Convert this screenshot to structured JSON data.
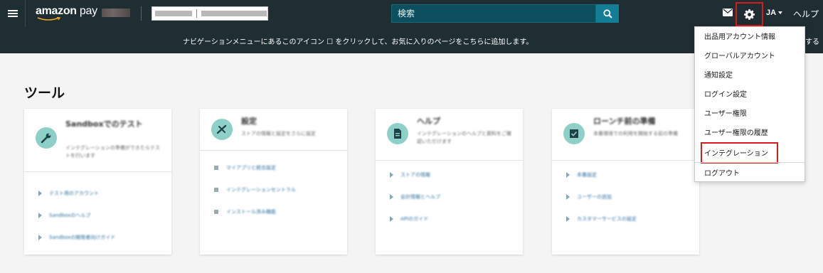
{
  "topbar": {
    "logo_amazon": "amazon",
    "logo_pay": " pay",
    "search_placeholder": "検索",
    "lang_label": "JA",
    "help_label": "ヘルプ",
    "icons": {
      "menu": "hamburger-menu-icon",
      "search": "search-icon",
      "mail": "mail-icon",
      "settings": "gear-icon",
      "lang_caret": "chevron-down-icon"
    }
  },
  "notice": {
    "text": "ナビゲーションメニューにあるこのアイコン ☐ をクリックして、お気に入りのページをこちらに追加します。",
    "suffix": "する"
  },
  "page": {
    "title": "ツール"
  },
  "cards": [
    {
      "title": "Sandboxでのテスト",
      "description": "インテグレーションの準備ができたらテストを行います",
      "icon": "wrench-icon",
      "bullet": "triangle",
      "links": [
        "テスト用のアカウント",
        "Sandboxのヘルプ",
        "Sandboxの開発者向けガイド"
      ]
    },
    {
      "title": "設定",
      "description": "ストアの情報と設定をさらに設定",
      "icon": "tools-icon",
      "bullet": "square",
      "links": [
        "マイアプリと統合設定",
        "インテグレーションセントラル",
        "インストール済み機能"
      ]
    },
    {
      "title": "ヘルプ",
      "description": "インテグレーションのヘルプと資料をご確認いただけます",
      "icon": "document-icon",
      "bullet": "triangle",
      "links": [
        "ストアの情報",
        "会計情報とヘルプ",
        "APIのガイド"
      ]
    },
    {
      "title": "ローンチ前の準備",
      "description": "本番環境での利用を開始する前の準備",
      "icon": "checklist-icon",
      "bullet": "triangle",
      "links": [
        "本番設定",
        "ユーザーの追加",
        "カスタマーサービスの設定"
      ]
    }
  ],
  "settings_menu": {
    "items": [
      "出品用アカウント情報",
      "グローバルアカウント",
      "通知設定",
      "ログイン設定",
      "ユーザー権限",
      "ユーザー権限の履歴",
      "インテグレーション",
      "ログアウト"
    ],
    "highlighted_item": "インテグレーション",
    "highlight_color": "#d81b1b"
  },
  "colors": {
    "topbar_bg": "#1f2e33",
    "search_bg": "#0d4f5e",
    "search_button": "#137e96",
    "icon_circle": "#8ed0c7",
    "link": "#2b6f9c"
  }
}
